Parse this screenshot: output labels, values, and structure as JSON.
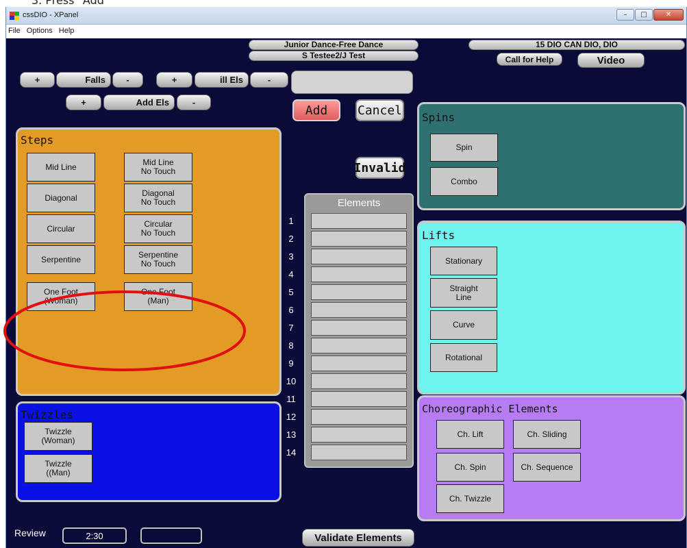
{
  "caption": "3.  Press \"Add\"",
  "window": {
    "title": "cssDIO - XPanel",
    "minimize_glyph": "–",
    "maximize_glyph": "□",
    "close_glyph": "✕"
  },
  "menu": [
    "File",
    "Options",
    "Help"
  ],
  "header": {
    "event": "Junior Dance-Free Dance",
    "skaters": "S Testee2/J Test",
    "panel_id": "15 DIO CAN DIO, DIO",
    "call_for_help": "Call for Help",
    "video": "Video"
  },
  "deductions": {
    "plus": "+",
    "minus": "-",
    "falls": "Falls",
    "ill_els": "ill Els",
    "add_els": "Add Els"
  },
  "entry_value": "",
  "actions": {
    "add": "Add",
    "cancel": "Cancel",
    "invalid": "Invalid",
    "validate": "Validate Elements"
  },
  "steps": {
    "title": "Steps",
    "items": [
      "Mid Line",
      "Mid Line\nNo Touch",
      "Diagonal",
      "Diagonal\nNo Touch",
      "Circular",
      "Circular\nNo Touch",
      "Serpentine",
      "Serpentine\nNo Touch",
      "One Foot\n(Woman)",
      "One Foot\n(Man)"
    ]
  },
  "twizzles": {
    "title": "Twizzles",
    "items": [
      "Twizzle\n(Woman)",
      "Twizzle\n((Man)"
    ]
  },
  "elements": {
    "title": "Elements",
    "numbers": [
      "1",
      "2",
      "3",
      "4",
      "5",
      "6",
      "7",
      "8",
      "9",
      "10",
      "11",
      "12",
      "13",
      "14"
    ]
  },
  "spins": {
    "title": "Spins",
    "items": [
      "Spin",
      "Combo"
    ]
  },
  "lifts": {
    "title": "Lifts",
    "items": [
      "Stationary",
      "Straight\nLine",
      "Curve",
      "Rotational"
    ]
  },
  "choreo": {
    "title": "Choreographic Elements",
    "items": [
      "Ch. Lift",
      "Ch. Sliding",
      "Ch. Spin",
      "Ch. Sequence",
      "Ch. Twizzle"
    ]
  },
  "footer": {
    "review": "Review",
    "time": "2:30",
    "extra": ""
  },
  "colors": {
    "background": "#0b0b3a",
    "steps_panel": "#e39b25",
    "twizzles_panel": "#0a10e6",
    "spins_panel": "#2f7070",
    "lifts_panel": "#6ff3ef",
    "choreo_panel": "#b77cf2",
    "add_button": "#f07777",
    "highlight_ellipse": "#e01010"
  }
}
